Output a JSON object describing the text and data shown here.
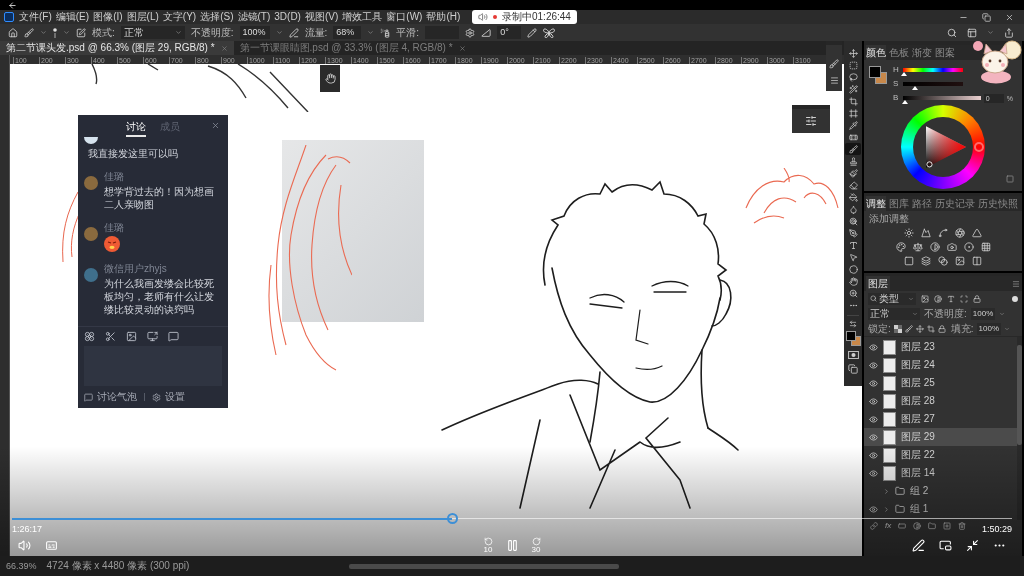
{
  "player": {
    "playing": true,
    "progress": {
      "level": 0.44
    },
    "elapsed": "1:26:17",
    "duration": "1:50:29",
    "rewind_label": "10",
    "forward_label": "30"
  },
  "recording": {
    "label": "录制中01:26:44"
  },
  "menu_bar": {
    "items": [
      "文件(F)",
      "编辑(E)",
      "图像(I)",
      "图层(L)",
      "文字(Y)",
      "选择(S)",
      "滤镜(T)",
      "3D(D)",
      "视图(V)",
      "增效工具",
      "窗口(W)",
      "帮助(H)"
    ]
  },
  "options_bar": {
    "mode": {
      "label": "模式:",
      "value": "正常"
    },
    "opacity": {
      "label": "不透明度:",
      "value": "100%"
    },
    "flow": {
      "label": "流量:",
      "value": "68%"
    },
    "smoothing": {
      "label": "平滑:"
    },
    "angle": {
      "value": "0°"
    }
  },
  "document_tabs": [
    {
      "title": "第二节课头发.psd @ 66.3% (图层 29, RGB/8) *",
      "selected": true
    },
    {
      "title": "第一节课眼睛图.psd @ 33.3% (图层 4, RGB/8) *",
      "selected": false
    }
  ],
  "ruler": {
    "ticks": [
      "100",
      "200",
      "300",
      "400",
      "500",
      "600",
      "700",
      "800",
      "900",
      "1000",
      "1100",
      "1200",
      "1300",
      "1400",
      "1500",
      "1600",
      "1700",
      "1800",
      "1900",
      "2000",
      "2100",
      "2200",
      "2300",
      "2400",
      "2500",
      "2600",
      "2700",
      "2800",
      "2900",
      "3000",
      "3100"
    ]
  },
  "chat": {
    "tabs": [
      {
        "label": "讨论",
        "selected": true
      },
      {
        "label": "成员",
        "selected": false
      }
    ],
    "messages": [
      {
        "kind": "text",
        "color": "#d6e3ee",
        "text": "我直接发这里可以吗"
      },
      {
        "kind": "text",
        "color": "#8a6a3e",
        "name": "佳璐",
        "text": "想学背过去的！因为想画二人亲吻图"
      },
      {
        "kind": "emoji",
        "color": "#8a6a3e",
        "name": "佳璐"
      },
      {
        "kind": "text",
        "color": "#3f6f8c",
        "name": "微信用户zhyjs",
        "text": "为什么我画发缕会比较死板均匀，老师有什么让发缕比较灵动的诀窍吗"
      }
    ],
    "bubble_label": "讨论气泡",
    "settings_label": "设置"
  },
  "toolbar": {
    "tools": [
      {
        "kind": "move",
        "selected": false
      },
      {
        "kind": "marquee",
        "selected": false
      },
      {
        "kind": "lasso",
        "selected": false
      },
      {
        "kind": "wand",
        "selected": false
      },
      {
        "kind": "crop",
        "selected": false
      },
      {
        "kind": "frame",
        "selected": false
      },
      {
        "kind": "eyedropper",
        "selected": false
      },
      {
        "kind": "healing",
        "selected": false
      },
      {
        "kind": "brush",
        "selected": true
      },
      {
        "kind": "stamp",
        "selected": false
      },
      {
        "kind": "history_brush",
        "selected": false
      },
      {
        "kind": "eraser",
        "selected": false
      },
      {
        "kind": "bucket",
        "selected": false
      },
      {
        "kind": "blur",
        "selected": false
      },
      {
        "kind": "dodge",
        "selected": false
      },
      {
        "kind": "pen",
        "selected": false
      },
      {
        "kind": "type",
        "selected": false
      },
      {
        "kind": "path_select",
        "selected": false
      },
      {
        "kind": "ellipse",
        "selected": false
      },
      {
        "kind": "hand",
        "selected": false
      },
      {
        "kind": "zoom",
        "selected": false
      },
      {
        "kind": "more",
        "selected": false
      }
    ]
  },
  "color_panel": {
    "tabs": [
      {
        "label": "颜色",
        "selected": true
      },
      {
        "label": "色板",
        "selected": false
      },
      {
        "label": "渐变",
        "selected": false
      },
      {
        "label": "图案",
        "selected": false
      }
    ],
    "sliders": [
      {
        "label": "H",
        "kind": "hue",
        "level": 0.02
      },
      {
        "label": "S",
        "kind": "saturation",
        "level": 0.2
      },
      {
        "label": "B",
        "kind": "brightness",
        "level": 0.02,
        "value": "0",
        "unit": "%"
      }
    ]
  },
  "adjustments_panel": {
    "tabs": [
      {
        "label": "调整",
        "selected": true
      },
      {
        "label": "图库",
        "selected": false
      },
      {
        "label": "路径",
        "selected": false
      },
      {
        "label": "历史记录",
        "selected": false
      },
      {
        "label": "历史快照",
        "selected": false
      }
    ],
    "title": "添加调整"
  },
  "layers_panel": {
    "tab": "图层",
    "filter": "类型",
    "blend_mode": "正常",
    "opacity_label": "不透明度:",
    "opacity_value": "100%",
    "lock_label": "锁定:",
    "fill_label": "填充:",
    "fill_value": "100%",
    "fx_label": "fx",
    "layers": [
      {
        "kind": "layer",
        "name": "图层 23",
        "visible": true,
        "selected": false
      },
      {
        "kind": "layer",
        "name": "图层 24",
        "visible": true,
        "selected": false
      },
      {
        "kind": "layer",
        "name": "图层 25",
        "visible": true,
        "selected": false
      },
      {
        "kind": "layer",
        "name": "图层 28",
        "visible": true,
        "selected": false
      },
      {
        "kind": "layer",
        "name": "图层 27",
        "visible": true,
        "selected": false
      },
      {
        "kind": "layer",
        "name": "图层 29",
        "visible": true,
        "selected": true
      },
      {
        "kind": "layer",
        "name": "图层 22",
        "visible": true,
        "selected": false
      },
      {
        "kind": "layer",
        "name": "图层 14",
        "visible": true,
        "selected": false
      },
      {
        "kind": "group",
        "name": "组 2",
        "visible": false,
        "selected": false,
        "expanded": false
      },
      {
        "kind": "group",
        "name": "组 1",
        "visible": true,
        "selected": false,
        "expanded": false
      }
    ]
  },
  "status_bar": {
    "zoom": "66.39%",
    "document_size": "4724 像素 x 4480 像素 (300 ppi)"
  }
}
